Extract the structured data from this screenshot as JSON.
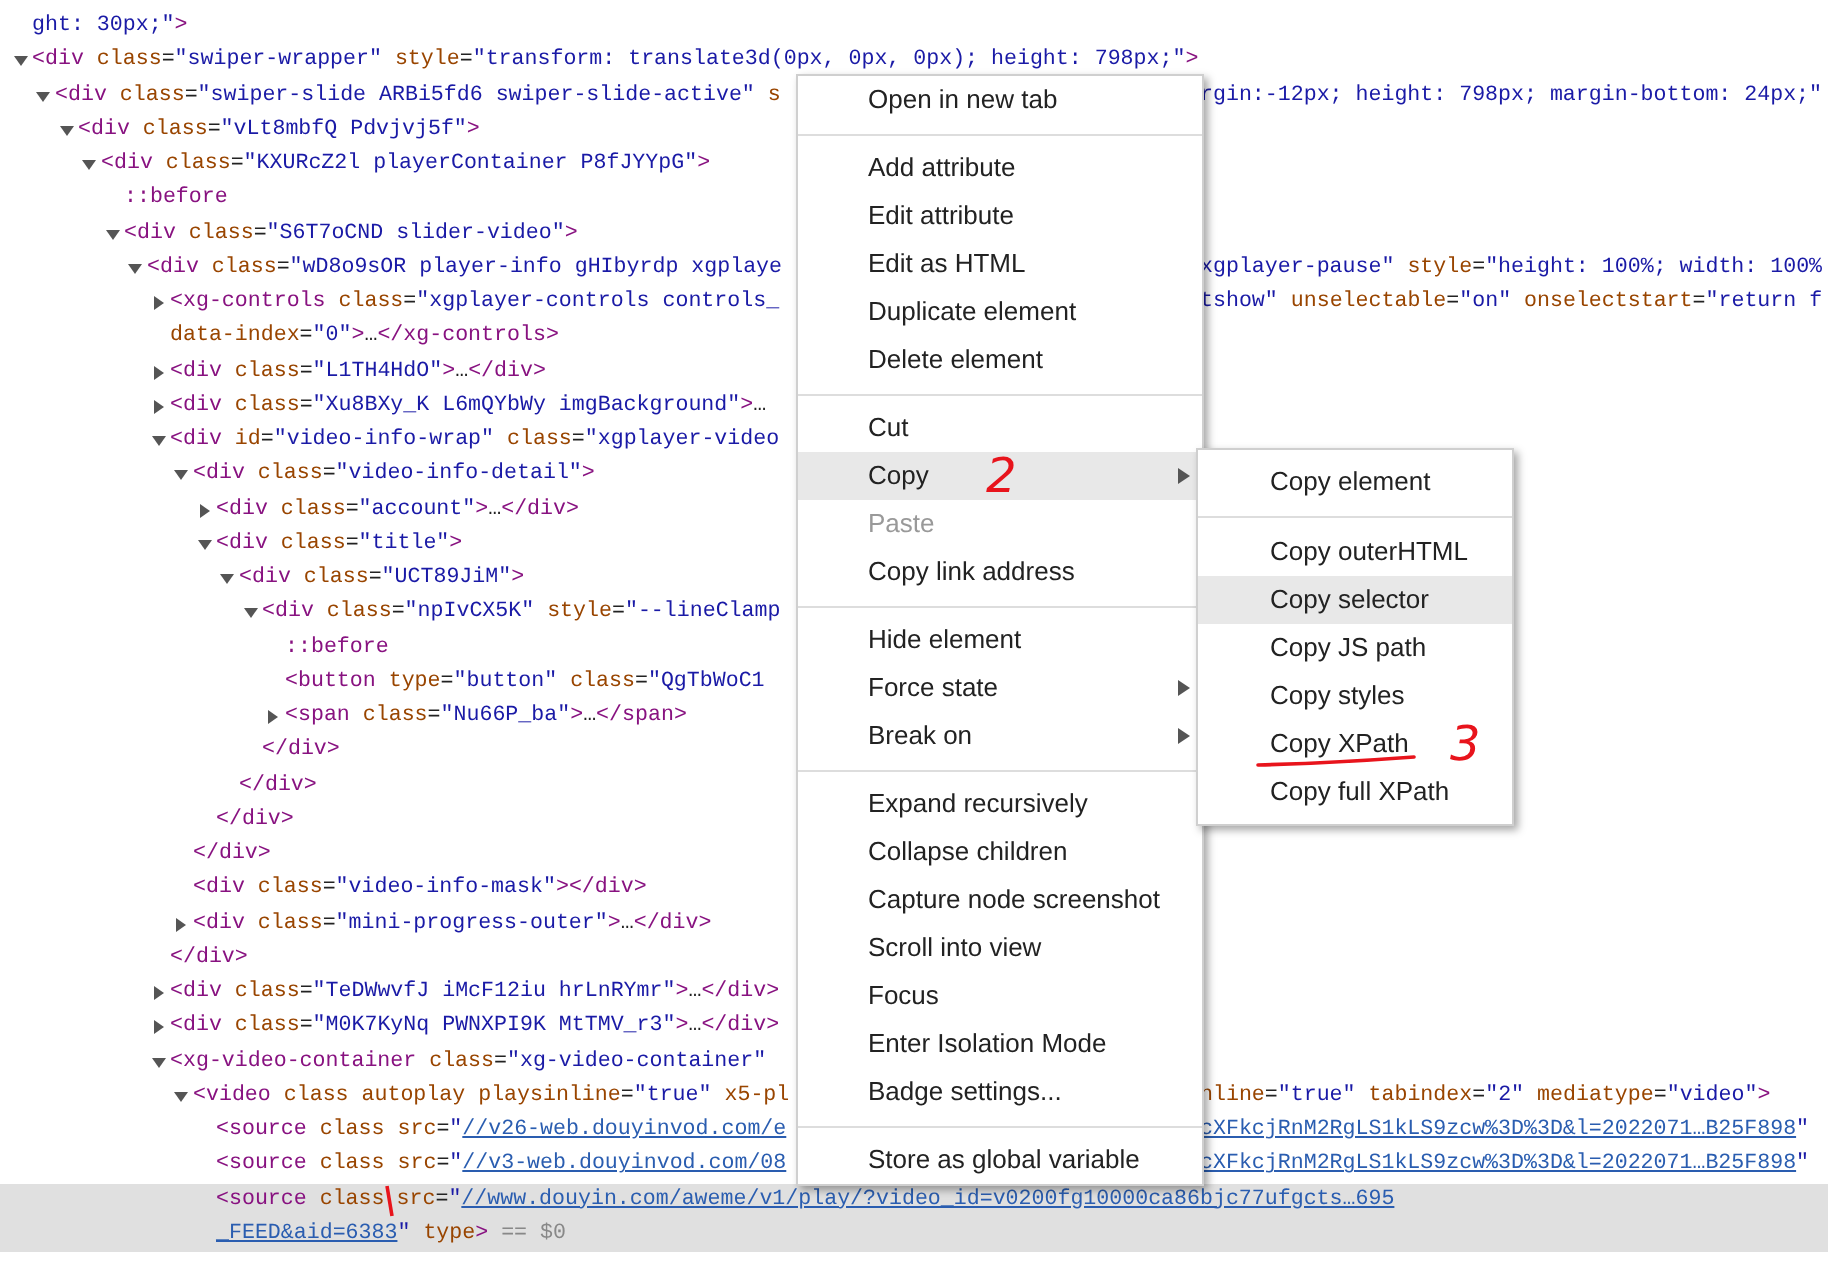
{
  "elements_tree": {
    "nodes": [
      {
        "selected": false,
        "open": [
          {
            "kind": "value",
            "text": "ght: 30px;\""
          },
          {
            "kind": "code",
            "text": ">"
          }
        ]
      },
      {
        "selected": false,
        "expanded": true,
        "open": [
          {
            "kind": "code",
            "text": "<div class=\"swiper-wrapper\" style=\"transform: translate3d(0px, 0px, 0px); height: 798px;\">"
          }
        ],
        "children": [
          {
            "selected": false,
            "expanded": true,
            "open": [
              {
                "kind": "code",
                "text": "<div class=\"swiper-slide ARBi5fd6 swiper-slide-active\" s"
              }
            ],
            "right": [
              {
                "kind": "value",
                "text": "rgin:-12px; height: 798px; margin-bottom: 24px;\""
              }
            ],
            "children": [
              {
                "selected": false,
                "expanded": true,
                "open": [
                  {
                    "kind": "code",
                    "text": "<div class=\"vLt8mbfQ Pdvjvj5f\">"
                  }
                ],
                "children": [
                  {
                    "selected": false,
                    "expanded": true,
                    "open": [
                      {
                        "kind": "code",
                        "text": "<div class=\"KXURcZ2l playerContainer P8fJYYpG\">"
                      }
                    ],
                    "children": [
                      {
                        "selected": false,
                        "open": [
                          {
                            "kind": "code",
                            "text": "::before"
                          }
                        ]
                      },
                      {
                        "selected": false,
                        "expanded": true,
                        "open": [
                          {
                            "kind": "code",
                            "text": "<div class=\"S6T7oCND slider-video\">"
                          }
                        ],
                        "children": [
                          {
                            "selected": false,
                            "expanded": true,
                            "open": [
                              {
                                "kind": "code",
                                "text": "<div class=\"wD8o9sOR player-info gHIbyrdp xgplaye"
                              }
                            ],
                            "right": [
                              {
                                "kind": "value",
                                "text": "xgplayer-pause\""
                              },
                              {
                                "kind": "code",
                                "text": " style=\"height: 100%; width: 100%"
                              }
                            ],
                            "children": [
                              {
                                "selected": false,
                                "expanded": false,
                                "open": [
                                  {
                                    "kind": "code",
                                    "text": "<xg-controls class=\"xgplayer-controls controls_"
                                  }
                                ],
                                "right": [
                                  {
                                    "kind": "value",
                                    "text": "tshow\""
                                  },
                                  {
                                    "kind": "code",
                                    "text": " unselectable=\"on\" onselectstart=\"return f"
                                  }
                                ],
                                "more": [
                                  {
                                    "kind": "code",
                                    "text": "data-index=\"0\">…</xg-controls>"
                                  }
                                ]
                              },
                              {
                                "selected": false,
                                "expanded": false,
                                "open": [
                                  {
                                    "kind": "code",
                                    "text": "<div class=\"L1TH4HdO\">…</div>"
                                  }
                                ]
                              },
                              {
                                "selected": false,
                                "expanded": false,
                                "open": [
                                  {
                                    "kind": "code",
                                    "text": "<div class=\"Xu8BXy_K L6mQYbWy imgBackground\">…"
                                  }
                                ]
                              },
                              {
                                "selected": false,
                                "expanded": true,
                                "open": [
                                  {
                                    "kind": "code",
                                    "text": "<div id=\"video-info-wrap\" class=\"xgplayer-video"
                                  }
                                ],
                                "close": [
                                  {
                                    "kind": "code",
                                    "text": "</div>"
                                  }
                                ],
                                "children": [
                                  {
                                    "selected": false,
                                    "expanded": true,
                                    "open": [
                                      {
                                        "kind": "code",
                                        "text": "<div class=\"video-info-detail\">"
                                      }
                                    ],
                                    "close": [
                                      {
                                        "kind": "code",
                                        "text": "</div>"
                                      }
                                    ],
                                    "children": [
                                      {
                                        "selected": false,
                                        "expanded": false,
                                        "open": [
                                          {
                                            "kind": "code",
                                            "text": "<div class=\"account\">…</div>"
                                          }
                                        ]
                                      },
                                      {
                                        "selected": false,
                                        "expanded": true,
                                        "open": [
                                          {
                                            "kind": "code",
                                            "text": "<div class=\"title\">"
                                          }
                                        ],
                                        "close": [
                                          {
                                            "kind": "code",
                                            "text": "</div>"
                                          }
                                        ],
                                        "children": [
                                          {
                                            "selected": false,
                                            "expanded": true,
                                            "open": [
                                              {
                                                "kind": "code",
                                                "text": "<div class=\"UCT89JiM\">"
                                              }
                                            ],
                                            "close": [
                                              {
                                                "kind": "code",
                                                "text": "</div>"
                                              }
                                            ],
                                            "children": [
                                              {
                                                "selected": false,
                                                "expanded": true,
                                                "open": [
                                                  {
                                                    "kind": "code",
                                                    "text": "<div class=\"npIvCX5K\" style=\"--lineClamp"
                                                  }
                                                ],
                                                "close": [
                                                  {
                                                    "kind": "code",
                                                    "text": "</div>"
                                                  }
                                                ],
                                                "children": [
                                                  {
                                                    "selected": false,
                                                    "open": [
                                                      {
                                                        "kind": "code",
                                                        "text": "::before"
                                                      }
                                                    ]
                                                  },
                                                  {
                                                    "selected": false,
                                                    "open": [
                                                      {
                                                        "kind": "code",
                                                        "text": "<button type=\"button\" class=\"QgTbWoC1"
                                                      }
                                                    ]
                                                  },
                                                  {
                                                    "selected": false,
                                                    "expanded": false,
                                                    "open": [
                                                      {
                                                        "kind": "code",
                                                        "text": "<span class=\"Nu66P_ba\">…</span>"
                                                      }
                                                    ]
                                                  }
                                                ]
                                              }
                                            ]
                                          }
                                        ]
                                      }
                                    ]
                                  },
                                  {
                                    "selected": false,
                                    "open": [
                                      {
                                        "kind": "code",
                                        "text": "<div class=\"video-info-mask\"></div>"
                                      }
                                    ]
                                  },
                                  {
                                    "selected": false,
                                    "expanded": false,
                                    "open": [
                                      {
                                        "kind": "code",
                                        "text": "<div class=\"mini-progress-outer\">…</div>"
                                      }
                                    ]
                                  }
                                ]
                              },
                              {
                                "selected": false,
                                "expanded": false,
                                "open": [
                                  {
                                    "kind": "code",
                                    "text": "<div class=\"TeDWwvfJ iMcF12iu hrLnRYmr\">…</div>"
                                  }
                                ]
                              },
                              {
                                "selected": false,
                                "expanded": false,
                                "open": [
                                  {
                                    "kind": "code",
                                    "text": "<div class=\"M0K7KyNq PWNXPI9K MtTMV_r3\">…</div>"
                                  }
                                ]
                              },
                              {
                                "selected": false,
                                "expanded": true,
                                "open": [
                                  {
                                    "kind": "code",
                                    "text": "<xg-video-container class=\"xg-video-container\""
                                  }
                                ],
                                "children": [
                                  {
                                    "selected": false,
                                    "expanded": true,
                                    "open": [
                                      {
                                        "kind": "code",
                                        "text": "<video class autoplay playsinline=\"true\" x5-pl"
                                      }
                                    ],
                                    "right": [
                                      {
                                        "kind": "code",
                                        "text": "nline=\"true\" tabindex=\"2\" mediatype=\"video\">"
                                      }
                                    ],
                                    "children": [
                                      {
                                        "selected": false,
                                        "open": [
                                          {
                                            "kind": "code",
                                            "text": "<source class src=\""
                                          },
                                          {
                                            "kind": "link",
                                            "text": "//v26-web.douyinvod.com/e"
                                          }
                                        ],
                                        "right": [
                                          {
                                            "kind": "link",
                                            "text": "cXFkcjRnM2RgLS1kLS9zcw%3D%3D&l=2022071…B25F898"
                                          },
                                          {
                                            "kind": "value",
                                            "text": "\""
                                          }
                                        ]
                                      },
                                      {
                                        "selected": false,
                                        "open": [
                                          {
                                            "kind": "code",
                                            "text": "<source class src=\""
                                          },
                                          {
                                            "kind": "link",
                                            "text": "//v3-web.douyinvod.com/08"
                                          }
                                        ],
                                        "right": [
                                          {
                                            "kind": "link",
                                            "text": "cXFkcjRnM2RgLS1kLS9zcw%3D%3D&l=2022071…B25F898"
                                          },
                                          {
                                            "kind": "value",
                                            "text": "\""
                                          }
                                        ]
                                      },
                                      {
                                        "selected": true,
                                        "open": [
                                          {
                                            "kind": "code",
                                            "text": "<source class"
                                          },
                                          {
                                            "kind": "stroke"
                                          },
                                          {
                                            "kind": "code",
                                            "text": "src=\""
                                          },
                                          {
                                            "kind": "link",
                                            "text": "//www.douyin.com/aweme/v1/play/?video_id=v0200fg10000ca86bjc77ufgcts…695"
                                          }
                                        ],
                                        "more": [
                                          {
                                            "kind": "link",
                                            "text": "_FEED&aid=6383"
                                          },
                                          {
                                            "kind": "value",
                                            "text": "\""
                                          },
                                          {
                                            "kind": "code",
                                            "text": " type>"
                                          },
                                          {
                                            "kind": "marker",
                                            "text": " == $0"
                                          }
                                        ]
                                      }
                                    ]
                                  }
                                ]
                              }
                            ]
                          }
                        ]
                      }
                    ]
                  }
                ]
              }
            ]
          }
        ]
      }
    ]
  },
  "context_menu": {
    "items": [
      {
        "kind": "item",
        "label": "Open in new tab",
        "disabled": false,
        "selected": false,
        "submenu": false
      },
      {
        "kind": "separator"
      },
      {
        "kind": "item",
        "label": "Add attribute",
        "disabled": false,
        "selected": false,
        "submenu": false
      },
      {
        "kind": "item",
        "label": "Edit attribute",
        "disabled": false,
        "selected": false,
        "submenu": false
      },
      {
        "kind": "item",
        "label": "Edit as HTML",
        "disabled": false,
        "selected": false,
        "submenu": false
      },
      {
        "kind": "item",
        "label": "Duplicate element",
        "disabled": false,
        "selected": false,
        "submenu": false
      },
      {
        "kind": "item",
        "label": "Delete element",
        "disabled": false,
        "selected": false,
        "submenu": false
      },
      {
        "kind": "separator"
      },
      {
        "kind": "item",
        "label": "Cut",
        "disabled": false,
        "selected": false,
        "submenu": false
      },
      {
        "kind": "item",
        "label": "Copy",
        "disabled": false,
        "selected": true,
        "submenu": true,
        "note": "2"
      },
      {
        "kind": "item",
        "label": "Paste",
        "disabled": true,
        "selected": false,
        "submenu": false
      },
      {
        "kind": "item",
        "label": "Copy link address",
        "disabled": false,
        "selected": false,
        "submenu": false
      },
      {
        "kind": "separator"
      },
      {
        "kind": "item",
        "label": "Hide element",
        "disabled": false,
        "selected": false,
        "submenu": false
      },
      {
        "kind": "item",
        "label": "Force state",
        "disabled": false,
        "selected": false,
        "submenu": true
      },
      {
        "kind": "item",
        "label": "Break on",
        "disabled": false,
        "selected": false,
        "submenu": true
      },
      {
        "kind": "separator"
      },
      {
        "kind": "item",
        "label": "Expand recursively",
        "disabled": false,
        "selected": false,
        "submenu": false
      },
      {
        "kind": "item",
        "label": "Collapse children",
        "disabled": false,
        "selected": false,
        "submenu": false
      },
      {
        "kind": "item",
        "label": "Capture node screenshot",
        "disabled": false,
        "selected": false,
        "submenu": false
      },
      {
        "kind": "item",
        "label": "Scroll into view",
        "disabled": false,
        "selected": false,
        "submenu": false
      },
      {
        "kind": "item",
        "label": "Focus",
        "disabled": false,
        "selected": false,
        "submenu": false
      },
      {
        "kind": "item",
        "label": "Enter Isolation Mode",
        "disabled": false,
        "selected": false,
        "submenu": false
      },
      {
        "kind": "item",
        "label": "Badge settings...",
        "disabled": false,
        "selected": false,
        "submenu": false
      },
      {
        "kind": "separator"
      },
      {
        "kind": "item",
        "label": "Store as global variable",
        "disabled": false,
        "selected": false,
        "submenu": false
      }
    ]
  },
  "copy_submenu": {
    "items": [
      {
        "kind": "item",
        "label": "Copy element",
        "selected": false,
        "underlined": false
      },
      {
        "kind": "separator"
      },
      {
        "kind": "item",
        "label": "Copy outerHTML",
        "selected": false,
        "underlined": false
      },
      {
        "kind": "item",
        "label": "Copy selector",
        "selected": true,
        "underlined": false
      },
      {
        "kind": "item",
        "label": "Copy JS path",
        "selected": false,
        "underlined": false
      },
      {
        "kind": "item",
        "label": "Copy styles",
        "selected": false,
        "underlined": false
      },
      {
        "kind": "item",
        "label": "Copy XPath",
        "selected": false,
        "underlined": true,
        "note": "3"
      },
      {
        "kind": "item",
        "label": "Copy full XPath",
        "selected": false,
        "underlined": false
      }
    ]
  }
}
